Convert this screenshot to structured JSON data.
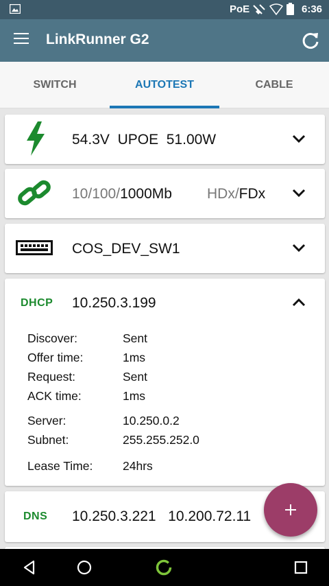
{
  "status_bar": {
    "poe_label": "PoE",
    "battery_level": "6",
    "time": "6:36"
  },
  "app_bar": {
    "title": "LinkRunner G2",
    "icons": [
      "menu-icon",
      "refresh-icon"
    ]
  },
  "tabs": [
    {
      "label": "SWITCH",
      "active": false
    },
    {
      "label": "AUTOTEST",
      "active": true
    },
    {
      "label": "CABLE",
      "active": false
    }
  ],
  "power": {
    "voltage": "54.3V",
    "class": "UPOE",
    "wattage": "51.00W"
  },
  "link": {
    "speeds_dim": "10/100/",
    "speed_active": "1000Mb",
    "duplex_dim": "HDx/",
    "duplex_active": "FDx"
  },
  "switch_card": {
    "name": "COS_DEV_SW1"
  },
  "dhcp": {
    "label": "DHCP",
    "ip": "10.250.3.199",
    "rows": [
      {
        "key": "Discover:",
        "value": "Sent"
      },
      {
        "key": "Offer time:",
        "value": "1ms"
      },
      {
        "key": "Request:",
        "value": "Sent"
      },
      {
        "key": "ACK time:",
        "value": "1ms"
      },
      {
        "key": "Server:",
        "value": "10.250.0.2"
      },
      {
        "key": "Subnet:",
        "value": "255.255.252.0"
      },
      {
        "key": "Lease Time:",
        "value": "24hrs"
      }
    ]
  },
  "dns": {
    "label": "DNS",
    "primary": "10.250.3.221",
    "secondary": "10.200.72.11"
  },
  "colors": {
    "status_bar": "#3d5a6a",
    "app_bar": "#4f7587",
    "accent": "#1c77b5",
    "green": "#1c8a2e",
    "fab": "#9c3d68"
  }
}
